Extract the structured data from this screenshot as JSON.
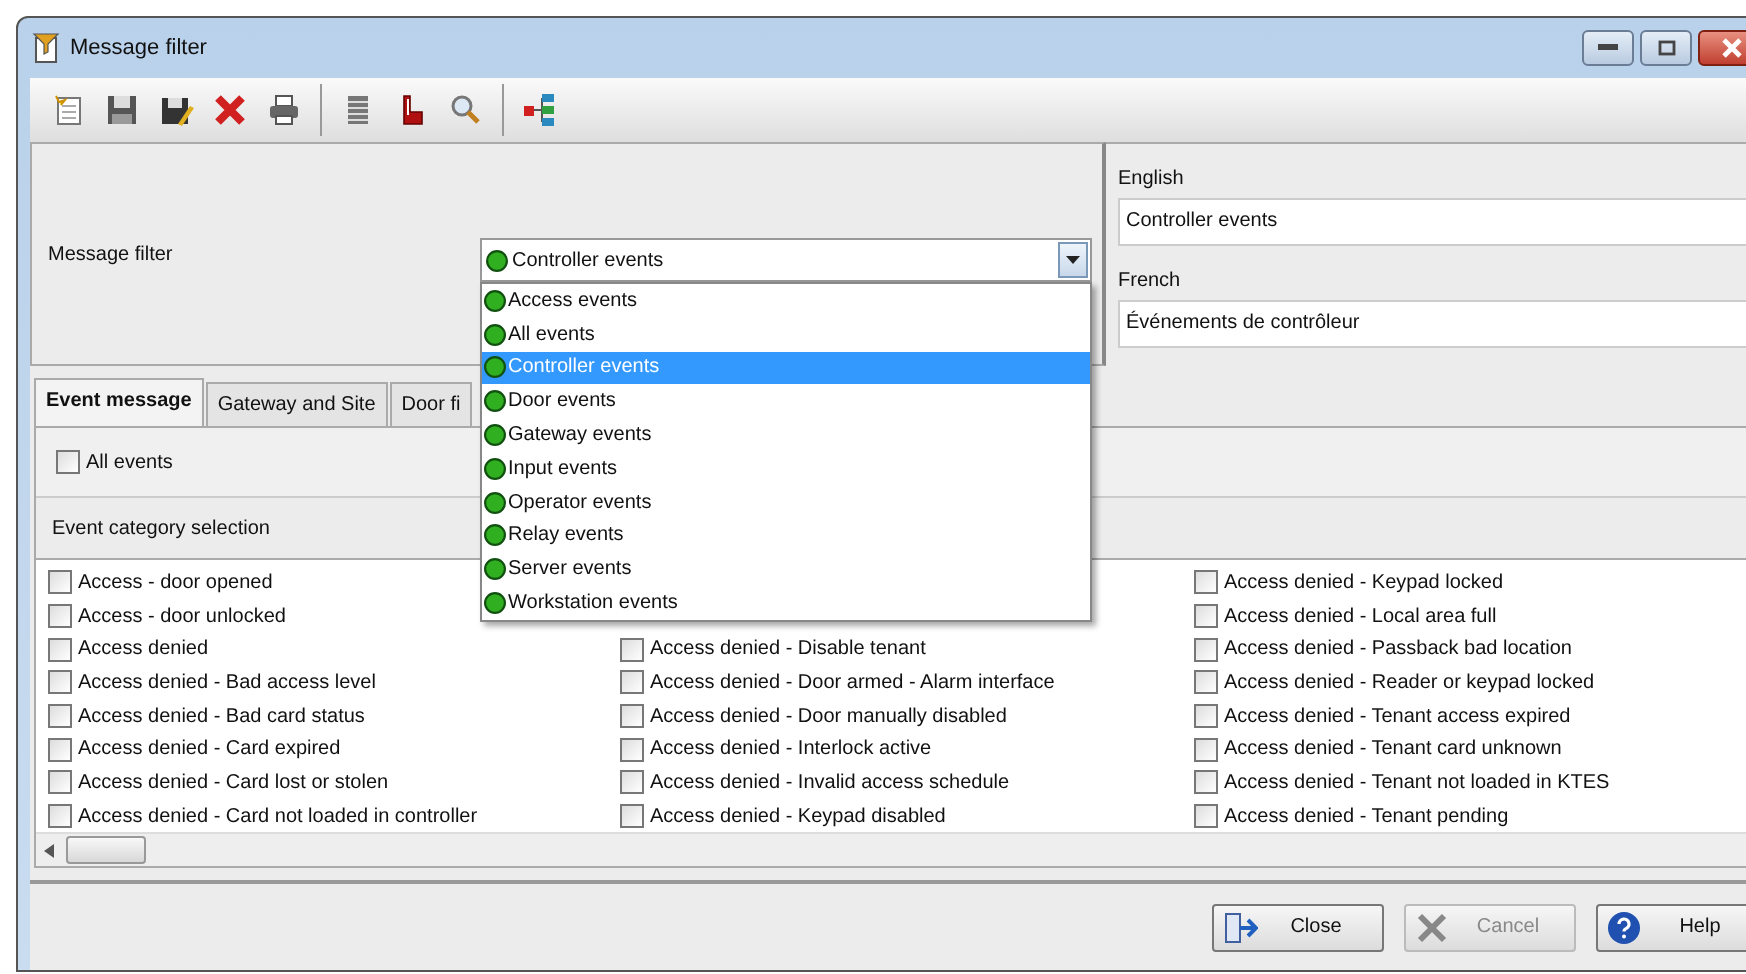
{
  "window": {
    "title": "Message filter"
  },
  "filter": {
    "label": "Message filter",
    "value": "Controller events",
    "expanded": true,
    "options": [
      {
        "label": "Access events",
        "selected": false
      },
      {
        "label": "All events",
        "selected": false
      },
      {
        "label": "Controller events",
        "selected": true
      },
      {
        "label": "Door events",
        "selected": false
      },
      {
        "label": "Gateway events",
        "selected": false
      },
      {
        "label": "Input events",
        "selected": false
      },
      {
        "label": "Operator events",
        "selected": false
      },
      {
        "label": "Relay events",
        "selected": false
      },
      {
        "label": "Server events",
        "selected": false
      },
      {
        "label": "Workstation events",
        "selected": false
      }
    ]
  },
  "translations": [
    {
      "language": "English",
      "value": "Controller events"
    },
    {
      "language": "French",
      "value": "Événements de contrôleur"
    }
  ],
  "tabs": [
    {
      "label": "Event message",
      "selected": true
    },
    {
      "label": "Gateway and Site",
      "selected": false
    },
    {
      "label": "Door fi",
      "selected": false
    }
  ],
  "all_events": {
    "label": "All events",
    "checked": false
  },
  "category_header": "Event category selection",
  "categories": [
    [
      {
        "label": "Access - door opened",
        "checked": false
      },
      {
        "label": "Access - door unlocked",
        "checked": false
      },
      {
        "label": "Access denied",
        "checked": false
      },
      {
        "label": "Access denied - Bad access level",
        "checked": false
      },
      {
        "label": "Access denied - Bad card status",
        "checked": false
      },
      {
        "label": "Access denied - Card expired",
        "checked": false
      },
      {
        "label": "Access denied - Card lost or stolen",
        "checked": false
      },
      {
        "label": "Access denied - Card not loaded in controller",
        "checked": false
      }
    ],
    [
      {
        "label": "Access denied - Disable tenant",
        "checked": false
      },
      {
        "label": "Access denied - Door armed - Alarm interface",
        "checked": false
      },
      {
        "label": "Access denied - Door manually disabled",
        "checked": false
      },
      {
        "label": "Access denied - Interlock active",
        "checked": false
      },
      {
        "label": "Access denied - Invalid access schedule",
        "checked": false
      },
      {
        "label": "Access denied - Keypad disabled",
        "checked": false
      }
    ],
    [
      {
        "label": "Access denied - Keypad locked",
        "checked": false
      },
      {
        "label": "Access denied - Local area full",
        "checked": false
      },
      {
        "label": "Access denied - Passback bad location",
        "checked": false
      },
      {
        "label": "Access denied - Reader or keypad locked",
        "checked": false
      },
      {
        "label": "Access denied - Tenant access expired",
        "checked": false
      },
      {
        "label": "Access denied - Tenant card unknown",
        "checked": false
      },
      {
        "label": "Access denied - Tenant not loaded in KTES",
        "checked": false
      },
      {
        "label": "Access denied - Tenant pending",
        "checked": false
      }
    ]
  ],
  "buttons": [
    {
      "kind": "close",
      "label": "Close",
      "disabled": false
    },
    {
      "kind": "cancel",
      "label": "Cancel",
      "disabled": true
    },
    {
      "kind": "help",
      "label": "Help",
      "disabled": false
    }
  ]
}
